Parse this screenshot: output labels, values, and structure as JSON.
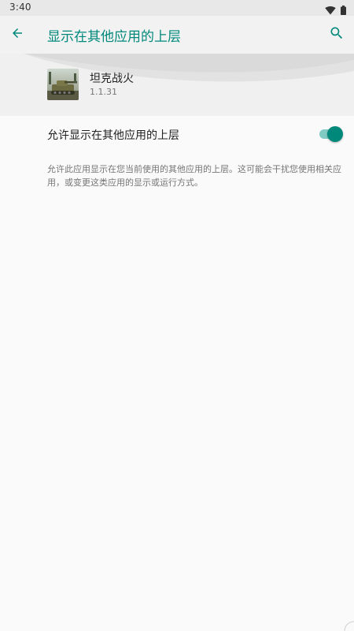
{
  "status_bar": {
    "time": "3:40",
    "icons": [
      "wifi-icon",
      "battery-icon"
    ]
  },
  "app_bar": {
    "title": "显示在其他应用的上层",
    "back_icon": "arrow-back-icon",
    "search_icon": "search-icon"
  },
  "app_info": {
    "name": "坦克战火",
    "version": "1.1.31"
  },
  "setting": {
    "label": "允许显示在其他应用的上层",
    "enabled": true
  },
  "description": "允许此应用显示在您当前使用的其他应用的上层。这可能会干扰您使用相关应用，或变更这类应用的显示或运行方式。",
  "colors": {
    "accent": "#00897b",
    "accent_light": "#80cbc4",
    "background": "#fafafa",
    "header_bg": "#f0f0f0"
  }
}
